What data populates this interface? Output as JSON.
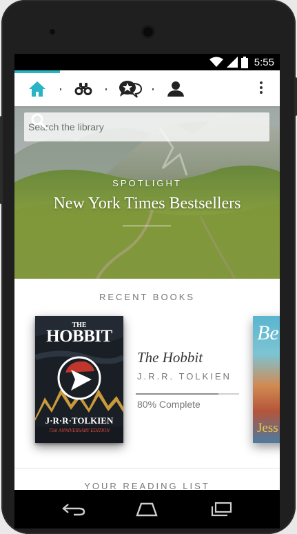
{
  "status_bar": {
    "time": "5:55"
  },
  "toolbar": {
    "tabs": [
      {
        "icon": "home-icon",
        "active": true
      },
      {
        "icon": "binoculars-icon",
        "active": false
      },
      {
        "icon": "chat-star-icon",
        "active": false
      },
      {
        "icon": "profile-icon",
        "active": false
      }
    ],
    "accent_color": "#28b4c4"
  },
  "search": {
    "placeholder": "Search the library"
  },
  "spotlight": {
    "kicker": "SPOTLIGHT",
    "title": "New York Times Bestsellers"
  },
  "recent_books": {
    "heading": "RECENT BOOKS",
    "items": [
      {
        "title": "The Hobbit",
        "author": "J.R.R. TOLKIEN",
        "progress_percent": 80,
        "progress_label": "80% Complete",
        "cover": {
          "top_small": "THE",
          "title": "HOBBIT",
          "author": "J·R·R·TOLKIEN",
          "edition": "75th ANNIVERSARY EDITION"
        }
      }
    ],
    "next_cover": {
      "title_fragment": "Be",
      "author_fragment": "Jess"
    }
  },
  "reading_list": {
    "heading": "YOUR READING LIST"
  }
}
